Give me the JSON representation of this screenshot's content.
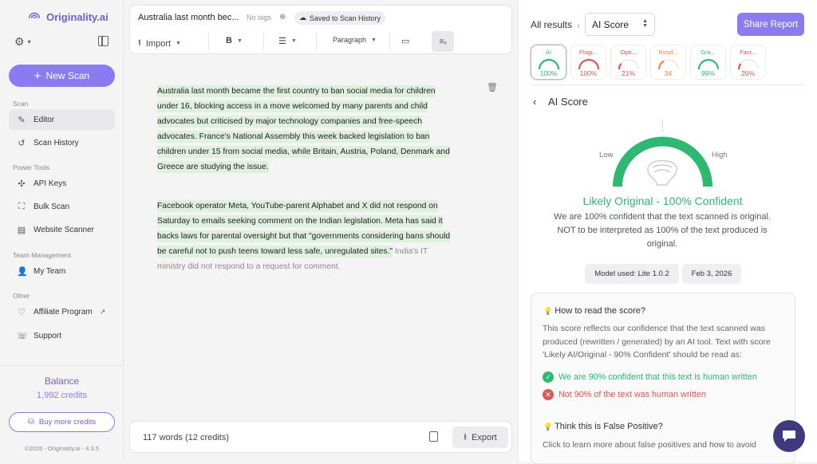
{
  "sidebar": {
    "logo": "Originality.ai",
    "new_scan": "New Scan",
    "sections": {
      "scan": "Scan",
      "power": "Power Tools",
      "team": "Team Management",
      "other": "Other"
    },
    "items": [
      {
        "label": "Editor"
      },
      {
        "label": "Scan History"
      },
      {
        "label": "API Keys"
      },
      {
        "label": "Bulk Scan"
      },
      {
        "label": "Website Scanner"
      },
      {
        "label": "My Team"
      },
      {
        "label": "Affiliate Program"
      },
      {
        "label": "Support"
      }
    ],
    "balance_label": "Balance",
    "credits": "1,992 credits",
    "buy_more": "Buy more credits",
    "copyright": "©2026 - Originality.ai - 4.3.5"
  },
  "editor": {
    "title": "Australia last month bec...",
    "no_tags": "No tags",
    "saved": "Saved to Scan History",
    "import": "Import",
    "bold": "B",
    "paragraph": "Paragraph",
    "p1": "Australia last month became the first country to ban social media for children under 16, blocking access in a move welcomed by many parents and child advocates but criticised by major technology companies and free-speech advocates. France's National Assembly this week backed legislation to ban children under 15 from social media, while Britain, Austria, Poland, Denmark and Greece are studying the issue.",
    "p2_hl": "Facebook operator Meta, YouTube-parent Alphabet and X did not respond on Saturday to emails seeking comment on the Indian legislation. Meta has said it backs laws for parental oversight but that \"governments considering bans should be careful not to push teens toward less safe, unregulated sites.\"",
    "p2_rest": " India's IT ministry did not respond to a request for comment.",
    "word_count": "117 words (12 credits)",
    "export": "Export"
  },
  "results": {
    "all_results": "All results",
    "select_value": "AI Score",
    "share": "Share Report",
    "tabs": [
      {
        "name": "AI",
        "value": "100%",
        "pct": 100,
        "color": "#2eb872"
      },
      {
        "name": "Plagi...",
        "value": "100%",
        "pct": 100,
        "color": "#e05555"
      },
      {
        "name": "Opti...",
        "value": "21%",
        "pct": 21,
        "color": "#e05555"
      },
      {
        "name": "Read...",
        "value": "34",
        "pct": 34,
        "color": "#f08a3c"
      },
      {
        "name": "Gra...",
        "value": "99%",
        "pct": 99,
        "color": "#2eb872"
      },
      {
        "name": "Fact...",
        "value": "20%",
        "pct": 20,
        "color": "#e05555"
      }
    ],
    "section_title": "AI Score",
    "low": "Low",
    "high": "High",
    "verdict": "Likely Original - 100% Confident",
    "description": "We are 100% confident that the text scanned is original. NOT to be interpreted as 100% of the text produced is original.",
    "model": "Model used: Lite 1.0.2",
    "date": "Feb 3, 2026",
    "how_title": "How to read the score?",
    "how_text": "This score reflects our confidence that the text scanned was produced (rewritten / generated) by an AI tool. Text with score 'Likely AI/Original - 90% Confident' should be read as:",
    "check_yes": "We are 90% confident that this text is human written",
    "check_no": "Not 90% of the text was human written",
    "fp_title": "Think this is False Positive?",
    "fp_text": "Click to learn more about false positives and how to avoid"
  },
  "colors": {
    "accent": "#8a7cf0",
    "green": "#2eb872",
    "red": "#e05555"
  }
}
